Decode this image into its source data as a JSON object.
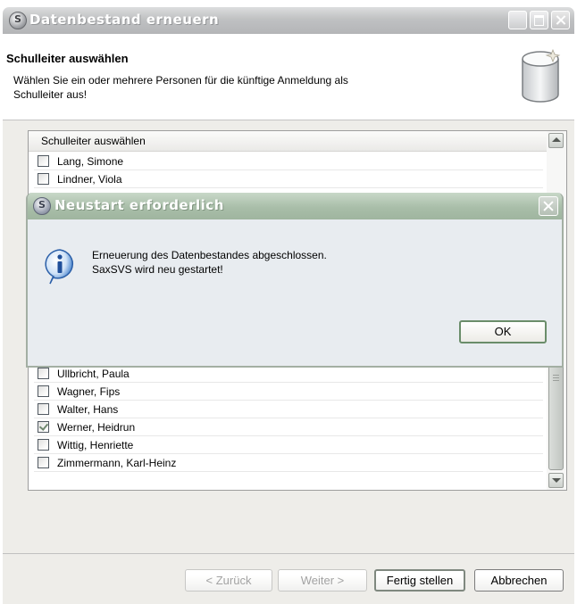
{
  "main_window": {
    "title": "Datenbestand erneuern",
    "header": {
      "title": "Schulleiter auswählen",
      "description_line1": "Wählen Sie ein oder mehrere Personen für die künftige Anmeldung als",
      "description_line2": "Schulleiter aus!"
    },
    "list": {
      "column_header": "Schulleiter auswählen",
      "top_rows": [
        {
          "name": "Lang, Simone",
          "checked": false
        },
        {
          "name": "Lindner, Viola",
          "checked": false
        }
      ],
      "bottom_rows": [
        {
          "name": "Ullbricht, Paula",
          "checked": false
        },
        {
          "name": "Wagner, Fips",
          "checked": false
        },
        {
          "name": "Walter, Hans",
          "checked": false
        },
        {
          "name": "Werner, Heidrun",
          "checked": true
        },
        {
          "name": "Wittig, Henriette",
          "checked": false
        },
        {
          "name": "Zimmermann, Karl-Heinz",
          "checked": false
        }
      ]
    },
    "buttons": {
      "back": "< Zurück",
      "next": "Weiter >",
      "finish": "Fertig stellen",
      "cancel": "Abbrechen"
    }
  },
  "dialog": {
    "title": "Neustart erforderlich",
    "message_line1": "Erneuerung des Datenbestandes abgeschlossen.",
    "message_line2": "SaxSVS wird neu gestartet!",
    "ok_label": "OK",
    "icon": "info-icon"
  },
  "colors": {
    "dialog_titlebar": "#a9bea9",
    "checkmark": "#3a9a3a",
    "info_icon": "#2a6fc4"
  }
}
